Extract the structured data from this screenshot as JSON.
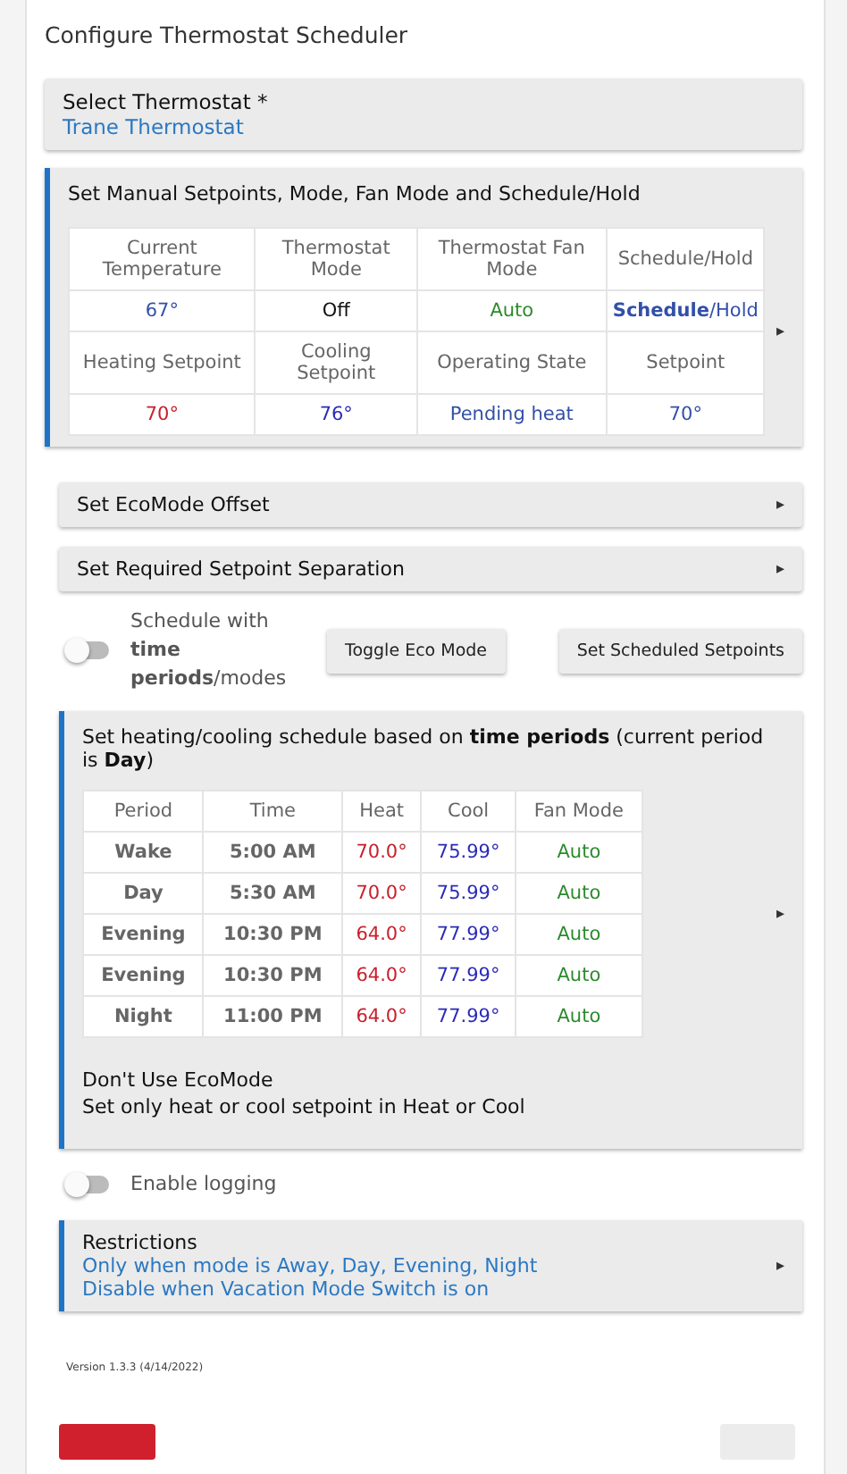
{
  "title": "Configure Thermostat Scheduler",
  "thermostat_select": {
    "label": "Select Thermostat *",
    "value": "Trane Thermostat"
  },
  "manual_panel": {
    "title": "Set Manual Setpoints, Mode, Fan Mode and Schedule/Hold",
    "rows": [
      [
        {
          "text": "Current Temperature",
          "kind": "head"
        },
        {
          "text": "Thermostat Mode",
          "kind": "head"
        },
        {
          "text": "Thermostat Fan Mode",
          "kind": "head"
        },
        {
          "text": "Schedule/Hold",
          "kind": "head"
        }
      ],
      [
        {
          "text": "67°",
          "kind": "temp"
        },
        {
          "text": "Off",
          "kind": "plain"
        },
        {
          "text": "Auto",
          "kind": "fan"
        },
        {
          "text": "**Schedule**/Hold",
          "kind": "temp"
        }
      ],
      [
        {
          "text": "Heating Setpoint",
          "kind": "head"
        },
        {
          "text": "Cooling Setpoint",
          "kind": "head"
        },
        {
          "text": "Operating State",
          "kind": "head"
        },
        {
          "text": "Setpoint",
          "kind": "head"
        }
      ],
      [
        {
          "text": "70°",
          "kind": "heat"
        },
        {
          "text": "76°",
          "kind": "cool"
        },
        {
          "text": "Pending heat",
          "kind": "temp"
        },
        {
          "text": "70°",
          "kind": "temp"
        }
      ]
    ],
    "arrow": "▸"
  },
  "collapsed_sections": [
    {
      "title": "Set EcoMode Offset",
      "arrow": "▸"
    },
    {
      "title": "Set Required Setpoint Separation",
      "arrow": "▸"
    }
  ],
  "schedule_toggle": {
    "label": "Schedule with **time periods**/modes",
    "on": false
  },
  "buttons": [
    "Toggle Eco Mode",
    "Set Scheduled Setpoints"
  ],
  "schedule_panel": {
    "title": "Set heating/cooling schedule based on **time periods** (current period is **Day**)",
    "arrow": "▸",
    "columns": [
      "Period",
      "Time",
      "Heat",
      "Cool",
      "Fan Mode"
    ],
    "rows": [
      {
        "period": "Wake",
        "time": "5:00 AM",
        "heat": "70.0°",
        "cool": "75.99°",
        "fan": "Auto"
      },
      {
        "period": "Day",
        "time": "5:30 AM",
        "heat": "70.0°",
        "cool": "75.99°",
        "fan": "Auto"
      },
      {
        "period": "Evening",
        "time": "10:30 PM",
        "heat": "64.0°",
        "cool": "77.99°",
        "fan": "Auto"
      },
      {
        "period": "Evening",
        "time": "10:30 PM",
        "heat": "64.0°",
        "cool": "77.99°",
        "fan": "Auto"
      },
      {
        "period": "Night",
        "time": "11:00 PM",
        "heat": "64.0°",
        "cool": "77.99°",
        "fan": "Auto"
      }
    ],
    "notes": [
      "Don't Use EcoMode",
      "Set only heat or cool setpoint in Heat or Cool"
    ]
  },
  "logging_toggle": {
    "label": "Enable logging",
    "on": false
  },
  "restrictions": {
    "title": "Restrictions",
    "lines": [
      "Only when mode is Away, Day, Evening, Night",
      "Disable when Vacation Mode Switch is on"
    ],
    "arrow": "▸"
  },
  "version": "Version 1.3.3 (4/14/2022)",
  "footer_buttons": [
    {
      "kind": "danger"
    },
    {
      "kind": "plain"
    }
  ]
}
